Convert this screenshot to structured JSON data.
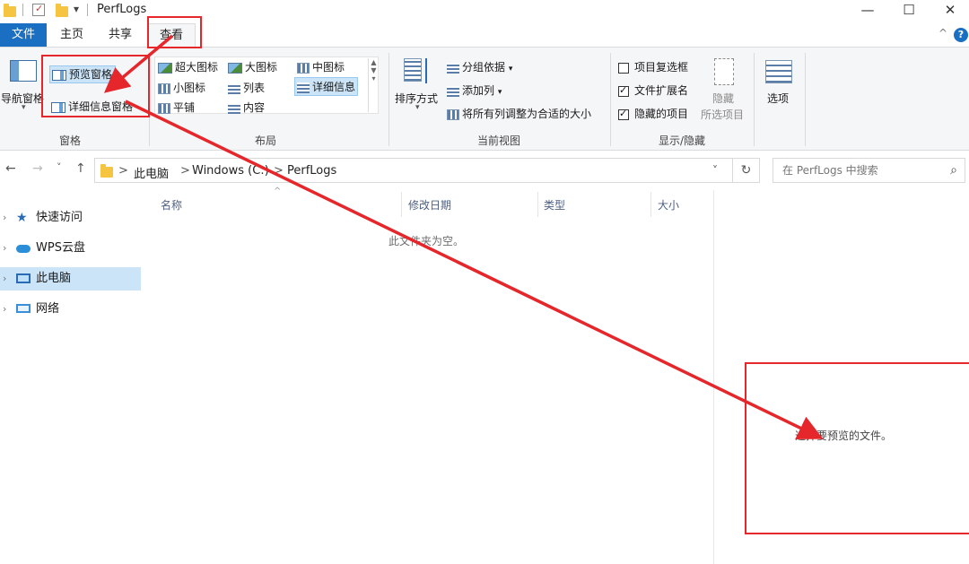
{
  "window": {
    "title": "PerfLogs",
    "controls": {
      "minimize": "—",
      "maximize": "☐",
      "close": "✕"
    },
    "qat_dropdown": "▾"
  },
  "tabs": [
    {
      "label": "文件"
    },
    {
      "label": "主页"
    },
    {
      "label": "共享"
    },
    {
      "label": "查看"
    }
  ],
  "ribbon": {
    "help_caret": "^",
    "help_icon": "?",
    "panes": {
      "nav_pane": "导航窗格",
      "preview_pane": "预览窗格",
      "details_pane": "详细信息窗格",
      "group_label": "窗格"
    },
    "layout": {
      "items": [
        "超大图标",
        "大图标",
        "中图标",
        "小图标",
        "列表",
        "详细信息",
        "平铺",
        "内容"
      ],
      "group_label": "布局"
    },
    "current_view": {
      "sort": "排序方式",
      "group_by": "分组依据",
      "add_col": "添加列",
      "fit_cols": "将所有列调整为合适的大小",
      "group_label": "当前视图"
    },
    "show_hide": {
      "item_checkbox": {
        "label": "项目复选框",
        "checked": false
      },
      "file_ext": {
        "label": "文件扩展名",
        "checked": true
      },
      "hidden_items": {
        "label": "隐藏的项目",
        "checked": true
      },
      "hide_selected": "隐藏",
      "hide_selected_2": "所选项目",
      "group_label": "显示/隐藏"
    },
    "options": "选项"
  },
  "address": {
    "back": "←",
    "forward": "→",
    "recent": "˅",
    "up": "↑",
    "crumbs": [
      "此电脑",
      "Windows (C:)",
      "PerfLogs"
    ],
    "crumb_sep": ">",
    "dropdown": "˅",
    "refresh": "↻",
    "search_placeholder": "在 PerfLogs 中搜索",
    "search_icon": "⌕"
  },
  "nav": [
    {
      "label": "快速访问",
      "icon": "star-icon"
    },
    {
      "label": "WPS云盘",
      "icon": "cloud-icon"
    },
    {
      "label": "此电脑",
      "icon": "computer-icon",
      "selected": true
    },
    {
      "label": "网络",
      "icon": "network-icon"
    }
  ],
  "columns": [
    "名称",
    "修改日期",
    "类型",
    "大小"
  ],
  "empty_message": "此文件夹为空。",
  "preview_message": "选择要预览的文件。",
  "annotation_color": "#e5262b",
  "accent_color": "#1a6fc2"
}
